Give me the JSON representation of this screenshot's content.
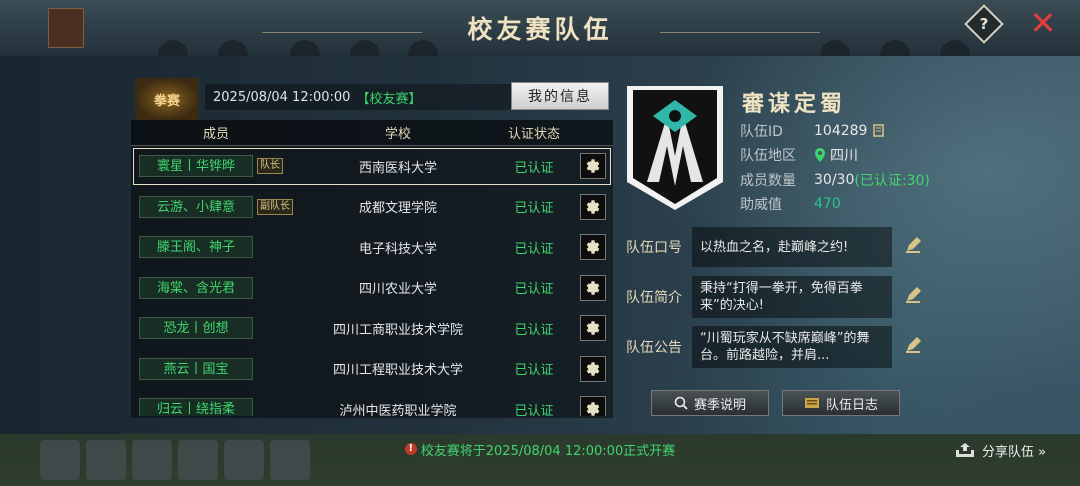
{
  "window": {
    "title": "校友赛队伍",
    "help_label": "?",
    "close_label": "✕"
  },
  "event": {
    "logo_text": "拳赛",
    "datetime": "2025/08/04 12:00:00",
    "tag": "【校友赛】",
    "my_info_label": "我的信息"
  },
  "table": {
    "headers": {
      "member": "成员",
      "school": "学校",
      "status": "认证状态"
    },
    "rows": [
      {
        "member": "寰星丨华铧晔",
        "role": "队长",
        "school": "西南医科大学",
        "status": "已认证"
      },
      {
        "member": "云游、小肆意",
        "role": "副队长",
        "school": "成都文理学院",
        "status": "已认证"
      },
      {
        "member": "滕王阁、神子",
        "role": "",
        "school": "电子科技大学",
        "status": "已认证"
      },
      {
        "member": "海棠、含光君",
        "role": "",
        "school": "四川农业大学",
        "status": "已认证"
      },
      {
        "member": "恐龙丨创想",
        "role": "",
        "school": "四川工商职业技术学院",
        "status": "已认证"
      },
      {
        "member": "燕云丨国宝",
        "role": "",
        "school": "四川工程职业技术大学",
        "status": "已认证"
      },
      {
        "member": "归云丨绕指柔",
        "role": "",
        "school": "泸州中医药职业学院",
        "status": "已认证"
      }
    ]
  },
  "team": {
    "name": "審谋定蜀",
    "id_label": "队伍ID",
    "id_value": "104289",
    "region_label": "队伍地区",
    "region_value": "四川",
    "members_label": "成员数量",
    "members_value": "30/30",
    "members_verified": "(已认证:30)",
    "support_label": "助威值",
    "support_value": "470",
    "slogan_label": "队伍口号",
    "slogan": "以热血之名，赴巅峰之约!",
    "intro_label": "队伍简介",
    "intro": "秉持“打得一拳开，免得百拳来”的决心!",
    "notice_label": "队伍公告",
    "notice": "“川蜀玩家从不缺席巅峰”的舞台。前路越险，并肩...",
    "season_btn": "赛季说明",
    "log_btn": "队伍日志"
  },
  "footer": {
    "notice": "校友赛将于2025/08/04 12:00:00正式开赛",
    "share_label": "分享队伍 »"
  },
  "colors": {
    "accent_green": "#3fd66f",
    "title_gold": "#efe2c0",
    "close_red": "#e33d3d"
  }
}
